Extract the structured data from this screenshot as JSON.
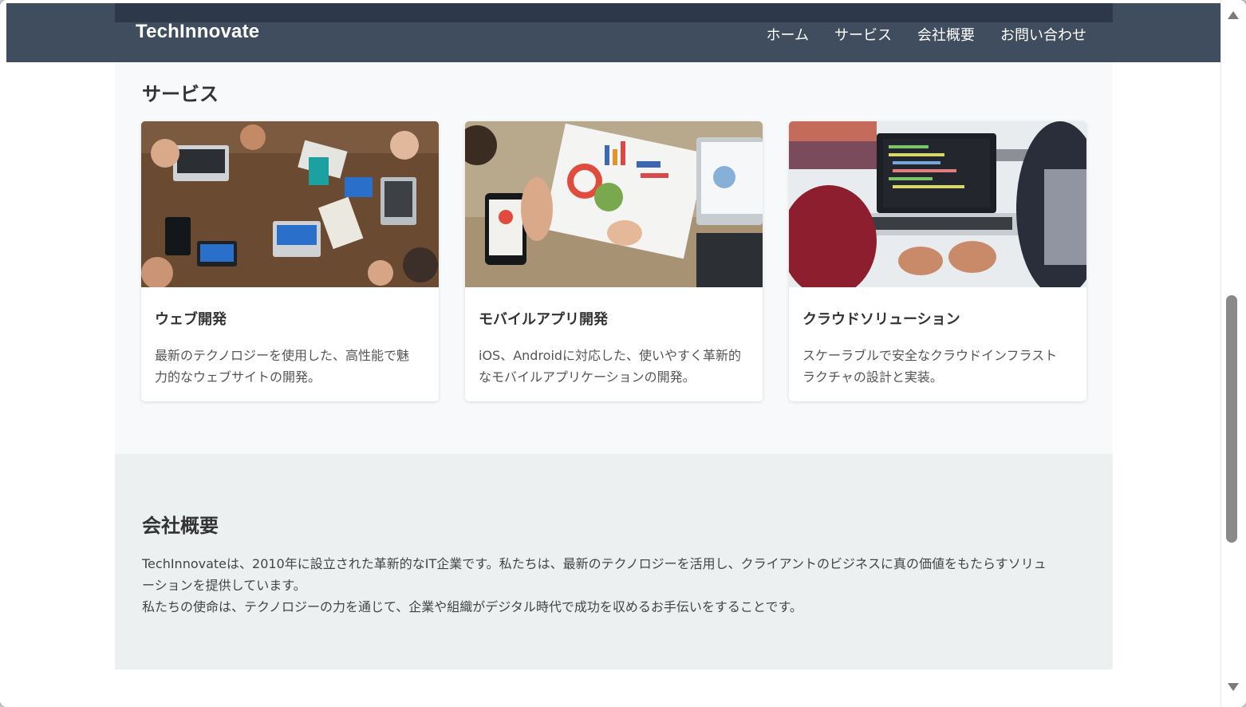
{
  "header": {
    "logo": "TechInnovate",
    "nav": [
      "ホーム",
      "サービス",
      "会社概要",
      "お問い合わせ"
    ]
  },
  "services": {
    "title": "サービス",
    "cards": [
      {
        "title": "ウェブ開発",
        "desc_lines": [
          "最新のテクノロジーを使用した、高性能で魅",
          "力的なウェブサイトの開発。"
        ],
        "image": "team-laptops-table-photo"
      },
      {
        "title": "モバイルアプリ開発",
        "desc_lines": [
          "iOS、Androidに対応した、使いやすく革新的",
          "なモバイルアプリケーションの開発。"
        ],
        "image": "phone-charts-photo"
      },
      {
        "title": "クラウドソリューション",
        "desc_lines": [
          "スケーラブルで安全なクラウドインフラスト",
          "ラクチャの設計と実装。"
        ],
        "image": "laptop-code-photo"
      }
    ]
  },
  "about": {
    "title": "会社概要",
    "lines": [
      "TechInnovateは、2010年に設立された革新的なIT企業です。私たちは、最新のテクノロジーを活用し、クライアントのビジネスに真の価値をもたらすソリュ",
      "ーションを提供しています。",
      "私たちの使命は、テクノロジーの力を通じて、企業や組織がデジタル時代で成功を収めるお手伝いをすることです。"
    ]
  },
  "colors": {
    "header_bg": "#3f4d5e",
    "services_bg": "#f8f9fa",
    "about_bg": "#ecf0f1"
  }
}
